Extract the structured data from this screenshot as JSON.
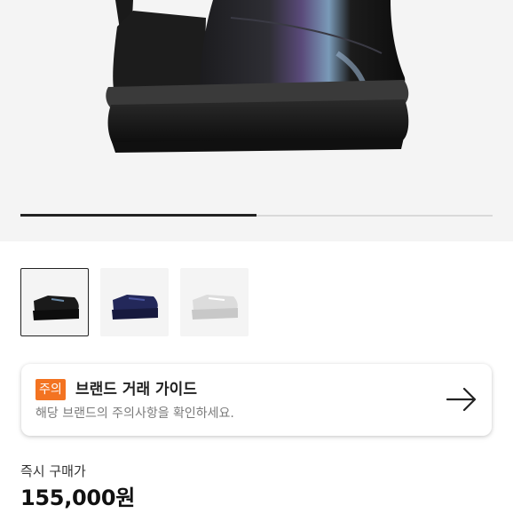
{
  "gallery": {
    "progress_fraction": 0.5,
    "thumbnails": [
      {
        "name": "black",
        "selected": true,
        "color": "#1a1a1a"
      },
      {
        "name": "navy",
        "selected": false,
        "color": "#23285a"
      },
      {
        "name": "silver",
        "selected": false,
        "color": "#e4e4e4"
      }
    ]
  },
  "guide": {
    "badge": "주의",
    "title": "브랜드 거래 가이드",
    "subtitle": "해당 브랜드의 주의사항을 확인하세요."
  },
  "purchase": {
    "label": "즉시 구매가",
    "price": "155,000원"
  },
  "colors": {
    "accent": "#f37321",
    "progress": "#222222"
  }
}
